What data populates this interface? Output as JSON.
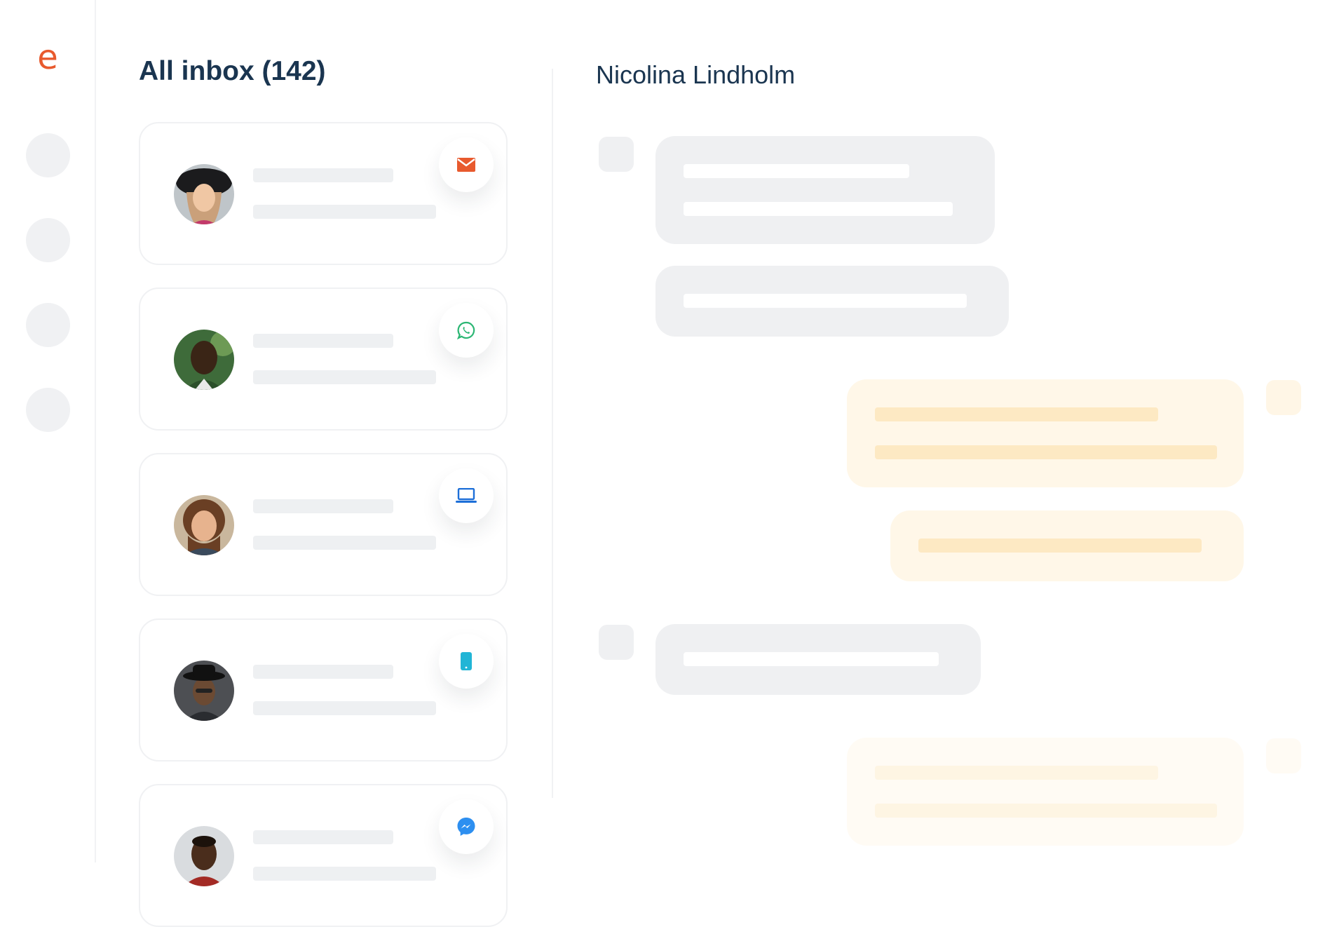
{
  "logo": {
    "text": "e",
    "color": "#e85a2e"
  },
  "rail": {
    "items": [
      "nav-1",
      "nav-2",
      "nav-3",
      "nav-4"
    ]
  },
  "inbox": {
    "title": "All inbox (142)",
    "conversations": [
      {
        "channel": "email-icon",
        "channel_color": "#e85a2e"
      },
      {
        "channel": "whatsapp-icon",
        "channel_color": "#2bb673"
      },
      {
        "channel": "laptop-icon",
        "channel_color": "#1d6fd8"
      },
      {
        "channel": "phone-icon",
        "channel_color": "#21b5d6"
      },
      {
        "channel": "messenger-icon",
        "channel_color": "#2d8ff0"
      }
    ]
  },
  "conversation": {
    "contact_name": "Nicolina Lindholm",
    "messages": [
      {
        "direction": "incoming"
      },
      {
        "direction": "incoming"
      },
      {
        "direction": "outgoing"
      },
      {
        "direction": "outgoing"
      },
      {
        "direction": "incoming"
      },
      {
        "direction": "outgoing"
      }
    ]
  },
  "colors": {
    "title": "#1a3550",
    "skeleton": "#eef0f2",
    "outgoing_bubble": "#fff7e8"
  }
}
